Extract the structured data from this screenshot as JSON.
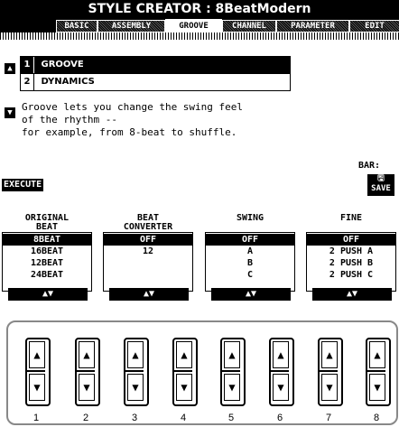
{
  "title": "STYLE CREATOR : 8BeatModern",
  "tabs": [
    "BASIC",
    "ASSEMBLY",
    "GROOVE",
    "CHANNEL",
    "PARAMETER",
    "EDIT"
  ],
  "active_tab": "GROOVE",
  "menu": [
    {
      "num": "1",
      "label": "GROOVE"
    },
    {
      "num": "2",
      "label": "DYNAMICS"
    }
  ],
  "description": [
    "Groove lets you change the swing feel",
    "of the rhythm --",
    "for example, from 8-beat to shuffle."
  ],
  "execute_label": "EXECUTE",
  "bar_label": "BAR:",
  "save_label": "SAVE",
  "columns": [
    {
      "header1": "ORIGINAL",
      "header2": "BEAT",
      "values": [
        "8BEAT",
        "16BEAT",
        "12BEAT",
        "24BEAT"
      ],
      "selected": "8BEAT"
    },
    {
      "header1": "BEAT",
      "header2": "CONVERTER",
      "values": [
        "OFF",
        "12"
      ],
      "selected": "OFF"
    },
    {
      "header1": "",
      "header2": "SWING",
      "values": [
        "OFF",
        "A",
        "B",
        "C"
      ],
      "selected": "OFF"
    },
    {
      "header1": "",
      "header2": "FINE",
      "values": [
        "OFF",
        "2 PUSH A",
        "2 PUSH B",
        "2 PUSH C"
      ],
      "selected": "OFF"
    }
  ],
  "arrow_label": "▲▼",
  "knob_numbers": [
    "1",
    "2",
    "3",
    "4",
    "5",
    "6",
    "7",
    "8"
  ]
}
